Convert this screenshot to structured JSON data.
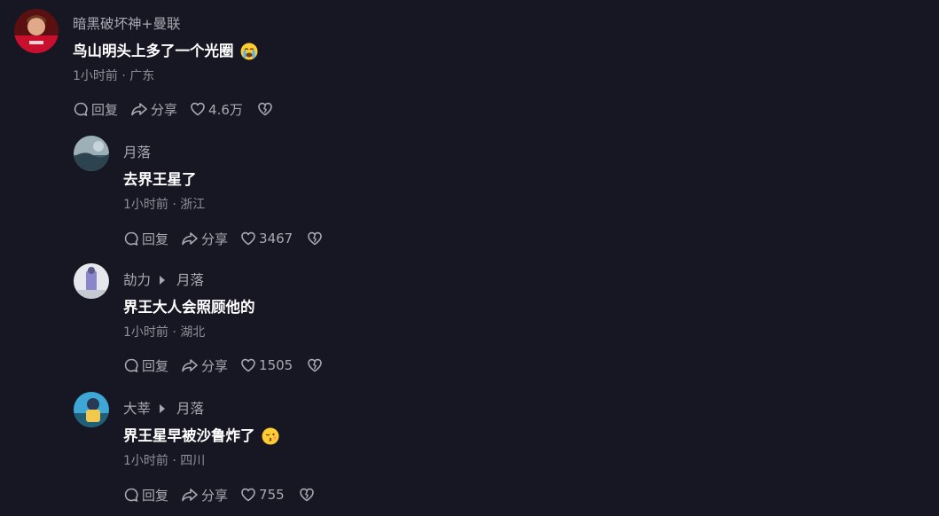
{
  "comments": [
    {
      "author": "暗黑破坏神+曼联",
      "text": "鸟山明头上多了一个光圈",
      "emoji": "crying-face",
      "time_location": "1小时前 · 广东",
      "reply_label": "回复",
      "share_label": "分享",
      "like_count": "4.6万"
    },
    {
      "author": "月落",
      "text": "去界王星了",
      "time_location": "1小时前 · 浙江",
      "reply_label": "回复",
      "share_label": "分享",
      "like_count": "3467"
    },
    {
      "author": "劼力",
      "reply_to": "月落",
      "text": "界王大人会照顾他的",
      "time_location": "1小时前 · 湖北",
      "reply_label": "回复",
      "share_label": "分享",
      "like_count": "1505"
    },
    {
      "author": "大莘",
      "reply_to": "月落",
      "text": "界王星早被沙鲁炸了",
      "emoji": "kissing-face",
      "time_location": "1小时前 · 四川",
      "reply_label": "回复",
      "share_label": "分享",
      "like_count": "755"
    }
  ],
  "colors": {
    "background": "#161722",
    "text_primary": "#ffffff",
    "text_secondary": "#a8a9b0"
  }
}
